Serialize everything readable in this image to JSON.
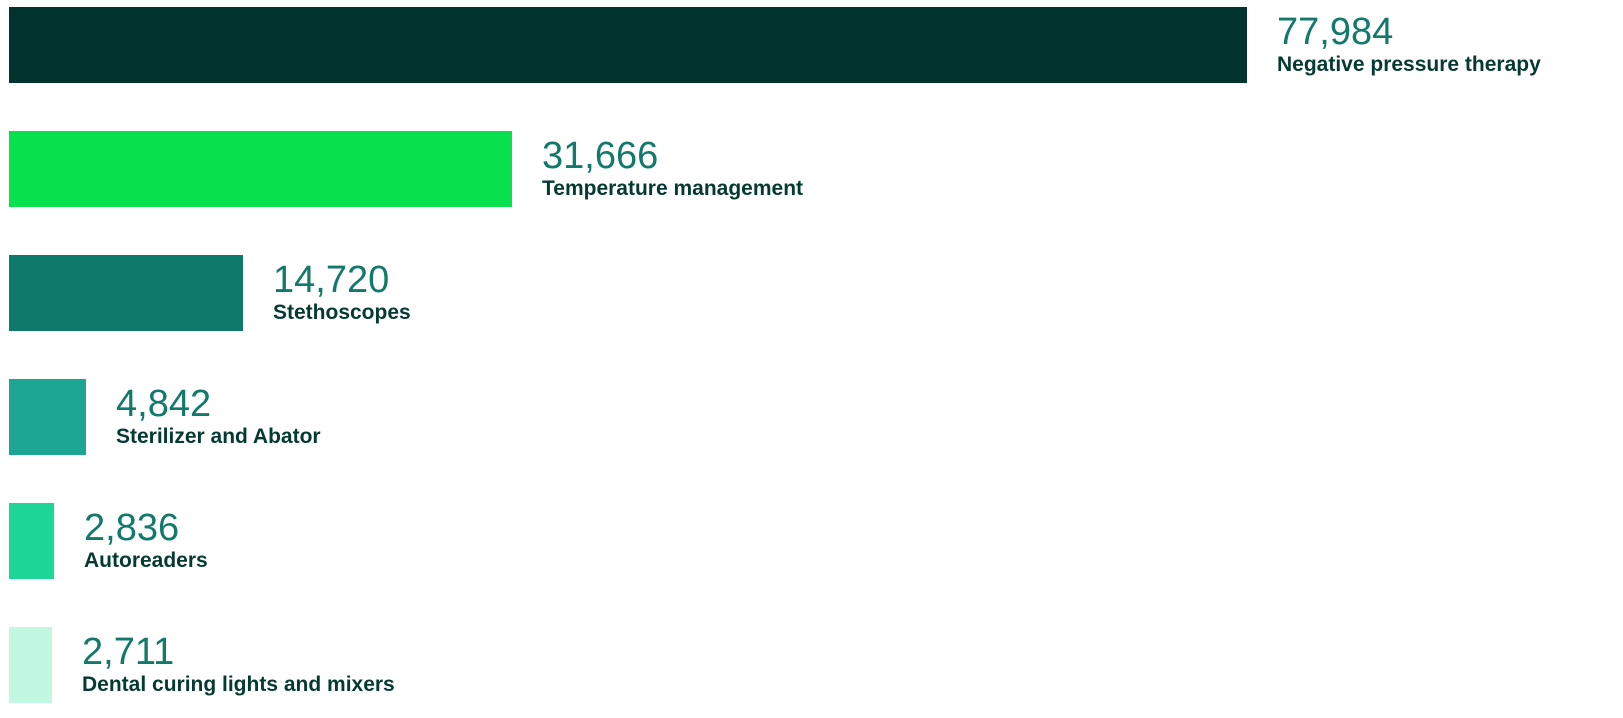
{
  "chart_data": {
    "type": "bar",
    "orientation": "horizontal",
    "categories": [
      "Negative pressure therapy",
      "Temperature management",
      "Stethoscopes",
      "Sterilizer and Abator",
      "Autoreaders",
      "Dental curing lights and mixers"
    ],
    "values": [
      77984,
      31666,
      14720,
      4842,
      2836,
      2711
    ],
    "value_labels": [
      "77,984",
      "31,666",
      "14,720",
      "4,842",
      "2,836",
      "2,711"
    ],
    "colors": [
      "#02332F",
      "#08E04D",
      "#0D7A6C",
      "#1DA594",
      "#1ED698",
      "#C2F8E2"
    ],
    "title": "",
    "xlabel": "",
    "ylabel": "",
    "xlim": [
      0,
      77984
    ],
    "grid": false,
    "legend": "none"
  }
}
